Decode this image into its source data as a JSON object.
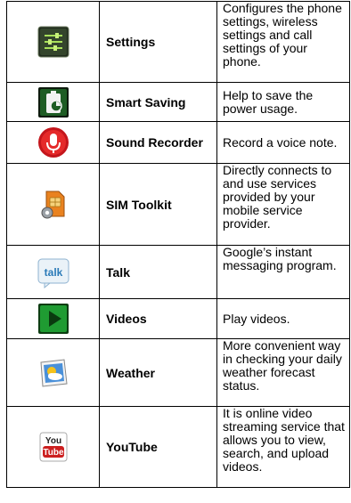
{
  "rows": [
    {
      "icon": "settings-icon",
      "name": "Settings",
      "desc": "Configures the phone settings, wireless settings and call settings of your phone."
    },
    {
      "icon": "smart-saving-icon",
      "name": "Smart Saving",
      "desc": "Help to save the power usage."
    },
    {
      "icon": "sound-recorder-icon",
      "name": "Sound Recorder",
      "desc": "Record a voice note."
    },
    {
      "icon": "sim-toolkit-icon",
      "name": "SIM Toolkit",
      "desc": "Directly connects to and use services provided by your mobile service provider."
    },
    {
      "icon": "talk-icon",
      "icon_text": "talk",
      "name": "Talk",
      "desc": "Google’s instant messaging program."
    },
    {
      "icon": "videos-icon",
      "name": "Videos",
      "desc": "Play videos."
    },
    {
      "icon": "weather-icon",
      "name": "Weather",
      "desc": "More convenient way in checking your daily weather forecast status."
    },
    {
      "icon": "youtube-icon",
      "icon_text_top": "You",
      "icon_text_bottom": "Tube",
      "name": "YouTube",
      "desc": "It is online video streaming service that allows you to view, search, and upload videos."
    }
  ]
}
